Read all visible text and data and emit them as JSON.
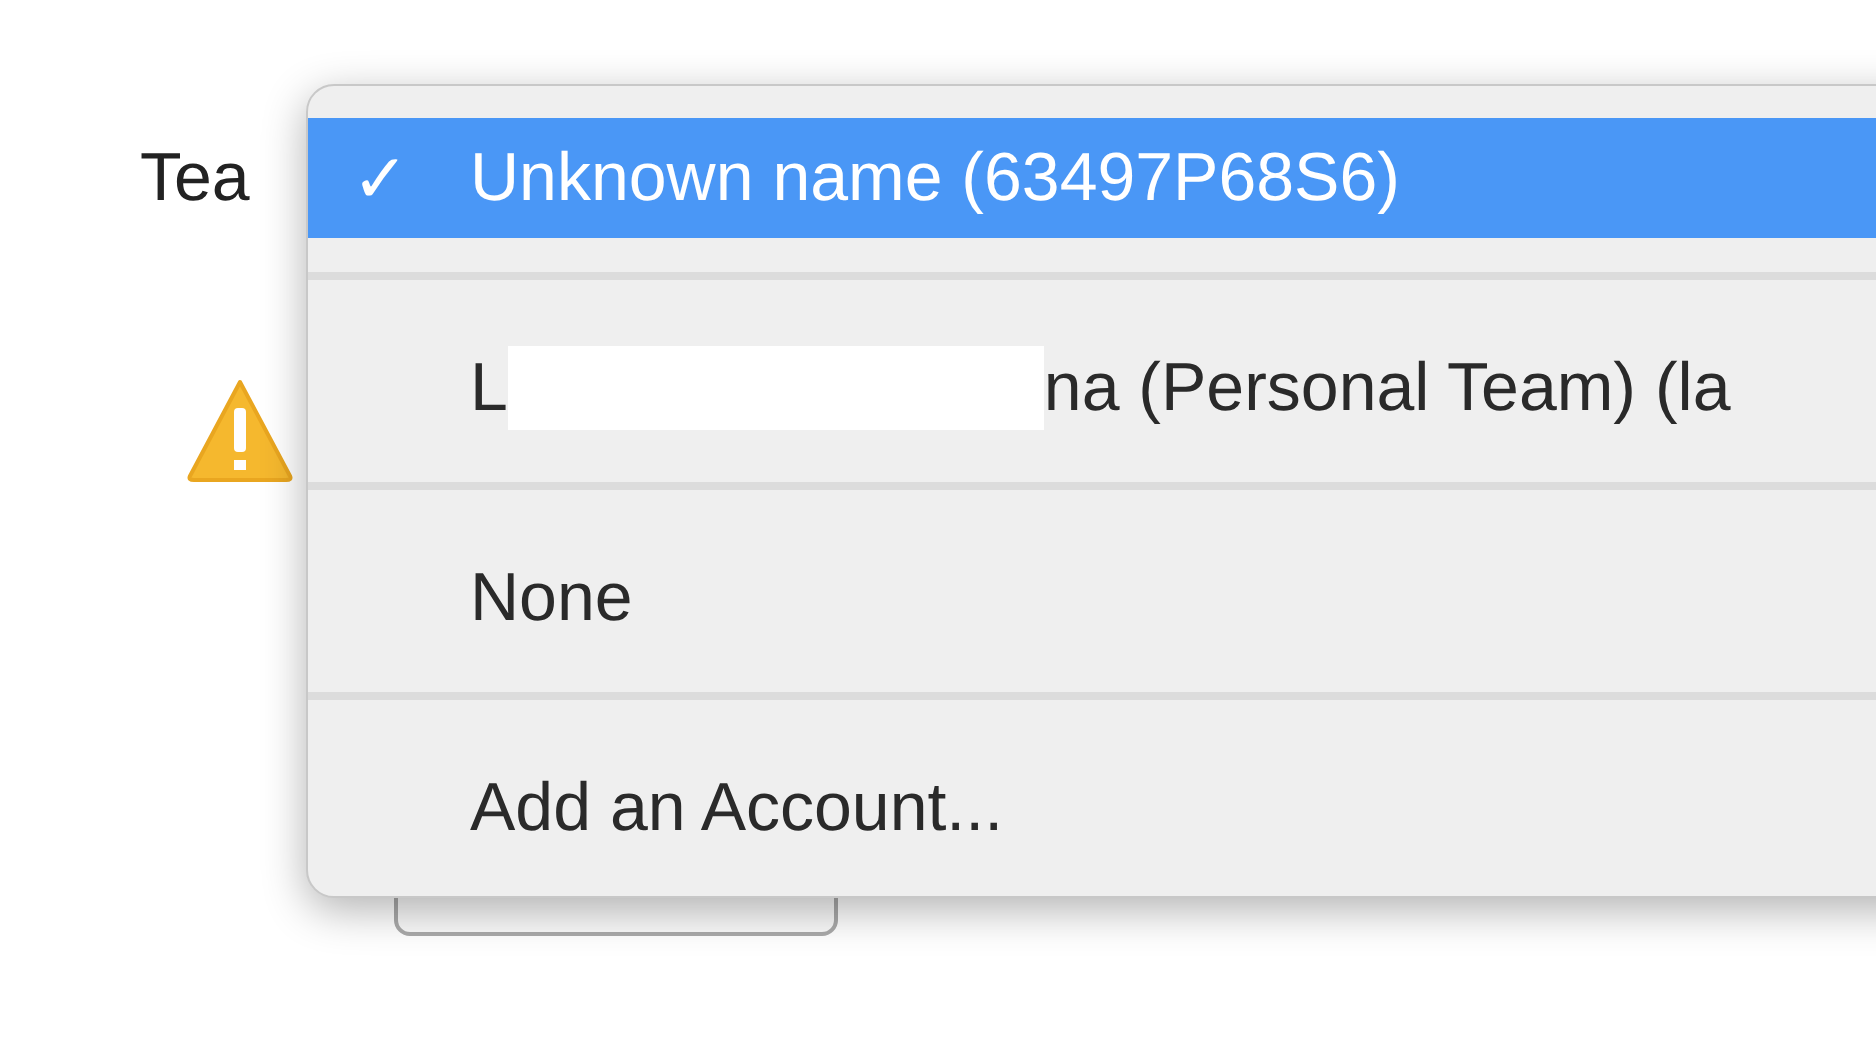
{
  "form": {
    "label": "Tea",
    "button": {
      "kind": "button"
    }
  },
  "menu": {
    "check": "✓",
    "items": [
      {
        "text": "Unknown name (63497P68S6)",
        "selected": true
      },
      {
        "text": "L",
        "redacted": true,
        "rest": "na (Personal Team) (la",
        "selected": false
      },
      {
        "text": "None",
        "selected": false
      },
      {
        "text": "Add an Account...",
        "selected": false
      }
    ]
  }
}
